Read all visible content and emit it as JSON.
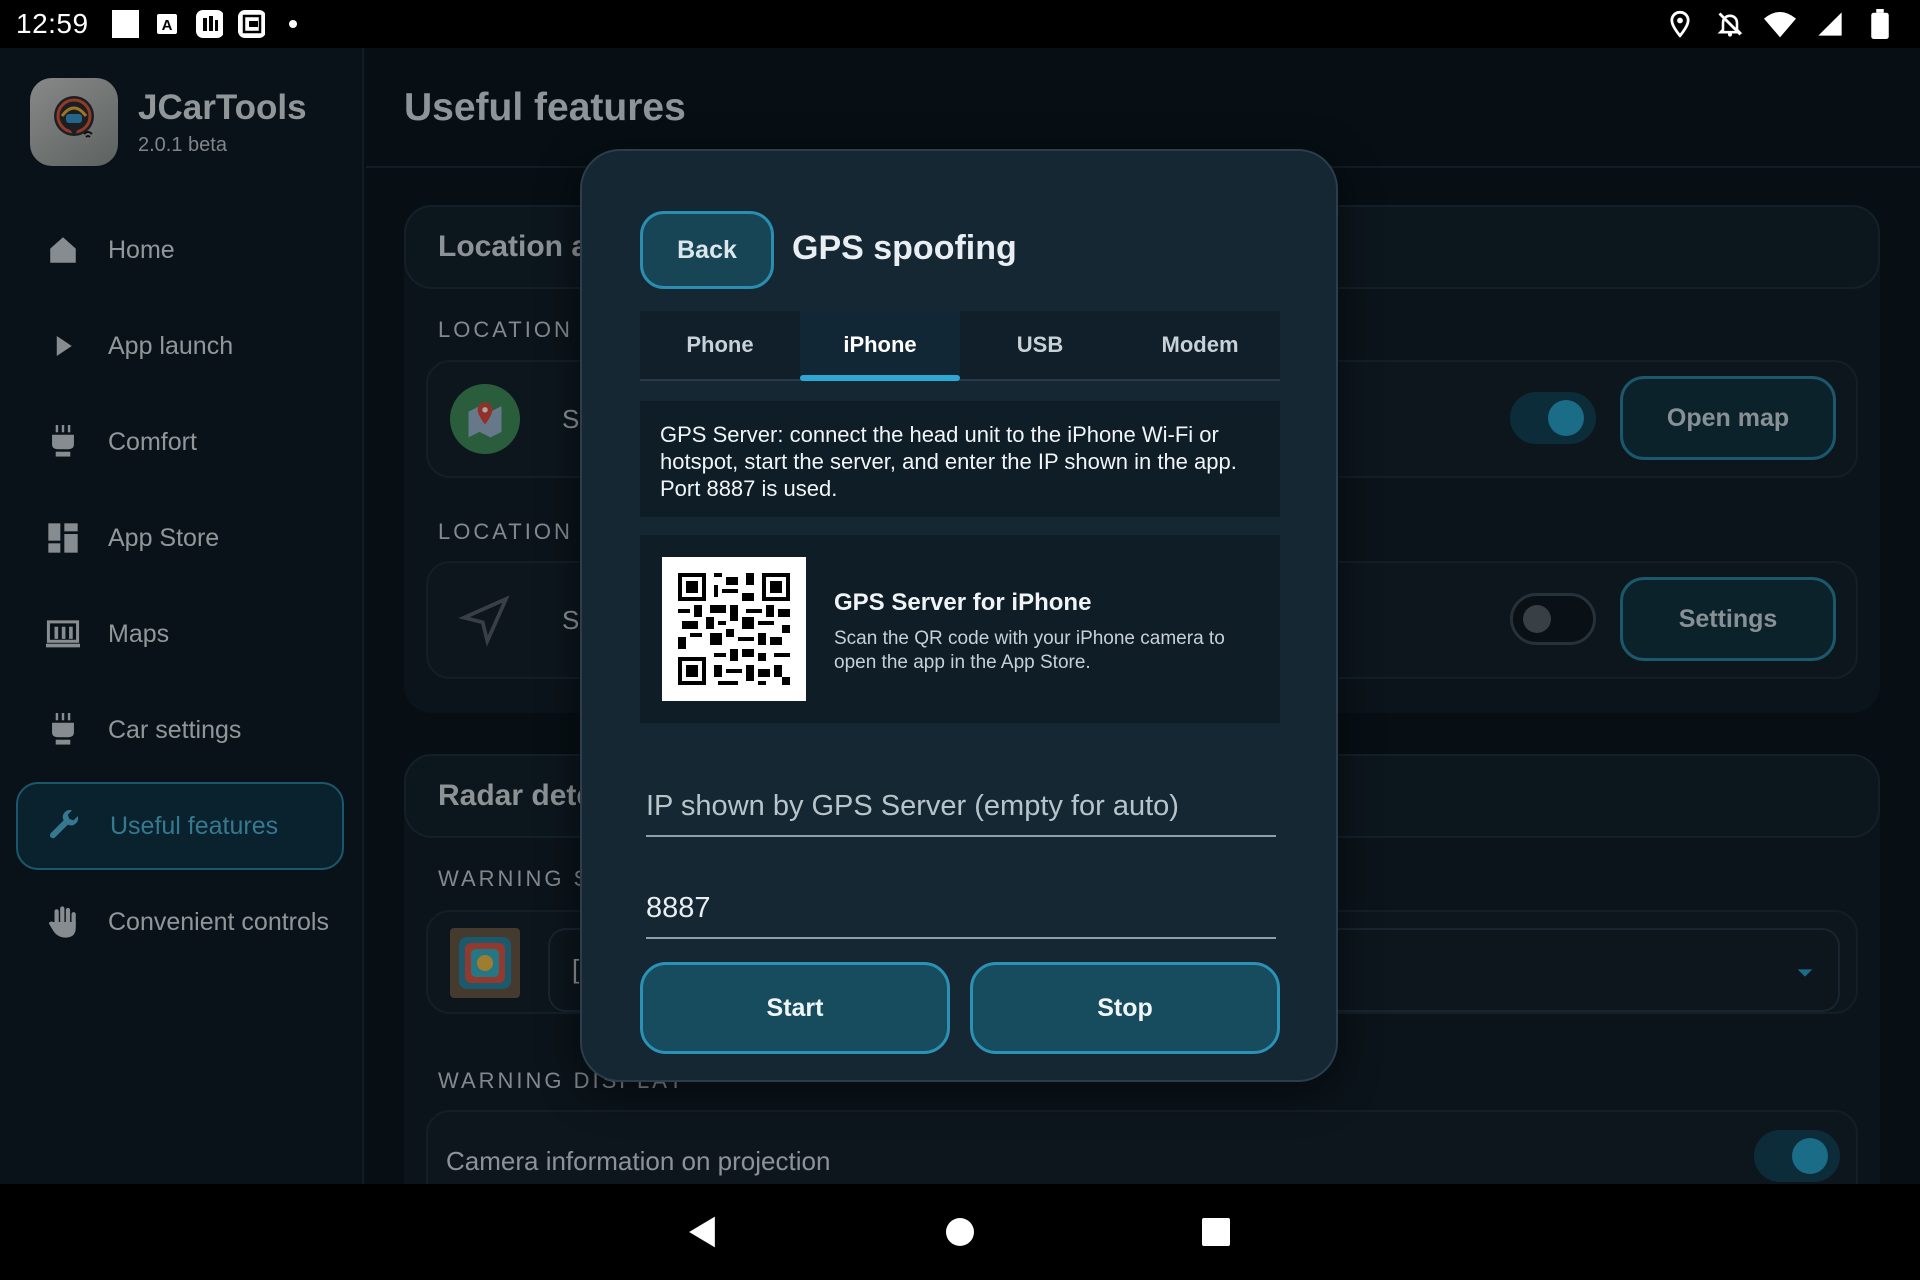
{
  "status_bar": {
    "time": "12:59",
    "notification_icons": [
      "white-square-icon",
      "a-text-icon",
      "news-icon",
      "clipboard-icon",
      "dot-icon"
    ],
    "system_icons": [
      "location-icon",
      "notifications-off-icon",
      "wifi-icon",
      "signal-icon",
      "battery-icon"
    ]
  },
  "app": {
    "name": "JCarTools",
    "version": "2.0.1 beta"
  },
  "sidebar": {
    "items": [
      {
        "label": "Home",
        "icon": "home-icon",
        "active": false
      },
      {
        "label": "App launch",
        "icon": "play-icon",
        "active": false
      },
      {
        "label": "Comfort",
        "icon": "seat-icon",
        "active": false
      },
      {
        "label": "App Store",
        "icon": "grid-icon",
        "active": false
      },
      {
        "label": "Maps",
        "icon": "map-icon",
        "active": false
      },
      {
        "label": "Car settings",
        "icon": "car-seat-icon",
        "active": false
      },
      {
        "label": "Useful features",
        "icon": "wrench-icon",
        "active": true
      },
      {
        "label": "Convenient controls",
        "icon": "hand-icon",
        "active": false
      }
    ]
  },
  "main": {
    "title": "Useful features",
    "location_section": {
      "header": "Location ar",
      "subhead_1": "LOCATION S",
      "card_1_text": "S",
      "card_1_button": "Open map",
      "card_1_toggle_on": true,
      "subhead_2": "LOCATION S",
      "card_2_text": "S",
      "card_2_button": "Settings",
      "card_2_toggle_on": false
    },
    "radar_section": {
      "header": "Radar dete",
      "subhead_1": "WARNING S(",
      "dropdown_text": "[",
      "subhead_2": "WARNING DISPLAY",
      "camera_row_label": "Camera information on projection",
      "camera_toggle_on": true
    }
  },
  "dialog": {
    "back_label": "Back",
    "title": "GPS spoofing",
    "tabs": [
      {
        "label": "Phone",
        "active": false
      },
      {
        "label": "iPhone",
        "active": true
      },
      {
        "label": "USB",
        "active": false
      },
      {
        "label": "Modem",
        "active": false
      }
    ],
    "info_text": "GPS Server: connect the head unit to the iPhone Wi-Fi or hotspot, start the server, and enter the IP shown in the app. Port 8887 is used.",
    "qr_title": "GPS Server for iPhone",
    "qr_description": "Scan the QR code with your iPhone camera to open the app in the App Store.",
    "ip_field": {
      "value": "",
      "placeholder": "IP shown by GPS Server (empty for auto)"
    },
    "port_field": {
      "value": "8887",
      "placeholder": ""
    },
    "start_label": "Start",
    "stop_label": "Stop"
  },
  "colors": {
    "accent": "#2ca8d2",
    "background": "#0b1720",
    "sidebar_active": "#0f3545"
  }
}
